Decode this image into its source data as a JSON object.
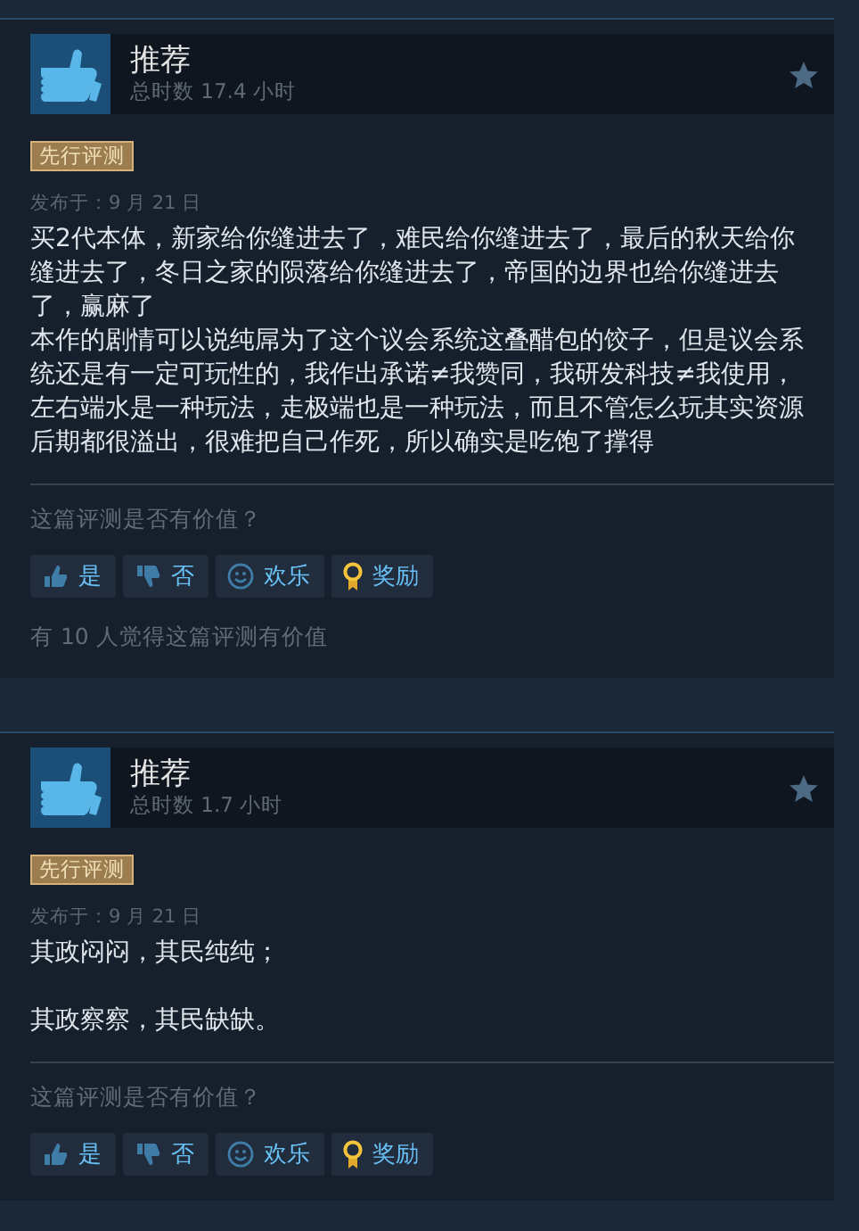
{
  "reviews": [
    {
      "verdict": "推荐",
      "hours": "总时数 17.4 小时",
      "badge": "先行评测",
      "posted": "发布于：9 月 21 日",
      "paragraphs": [
        {
          "text": "买2代本体，新家给你缝进去了，难民给你缝进去了，最后的秋天给你缝进去了，冬日之家的陨落给你缝进去了，帝国的边界也给你缝进去了，赢麻了"
        },
        {
          "text": "本作的剧情可以说纯屌为了这个议会系统这叠醋包的饺子，但是议会系统还是有一定可玩性的，我作出承诺≠我赞同，我研发科技≠我使用，左右端水是一种玩法，走极端也是一种玩法，而且不管怎么玩其实资源后期都很溢出，很难把自己作死，所以确实是吃饱了撑得"
        }
      ],
      "question": "这篇评测是否有价值？",
      "buttons": [
        {
          "kind": "yes",
          "label": "是"
        },
        {
          "kind": "no",
          "label": "否"
        },
        {
          "kind": "funny",
          "label": "欢乐"
        },
        {
          "kind": "award",
          "label": "奖励"
        }
      ],
      "helpful_count": "有 10 人觉得这篇评测有价值"
    },
    {
      "verdict": "推荐",
      "hours": "总时数 1.7 小时",
      "badge": "先行评测",
      "posted": "发布于：9 月 21 日",
      "paragraphs": [
        {
          "text": "其政闷闷，其民纯纯；"
        },
        {
          "text": "其政察察，其民缺缺。",
          "blank_line_before": true
        }
      ],
      "question": "这篇评测是否有价值？",
      "buttons": [
        {
          "kind": "yes",
          "label": "是"
        },
        {
          "kind": "no",
          "label": "否"
        },
        {
          "kind": "funny",
          "label": "欢乐"
        },
        {
          "kind": "award",
          "label": "奖励"
        }
      ]
    }
  ]
}
